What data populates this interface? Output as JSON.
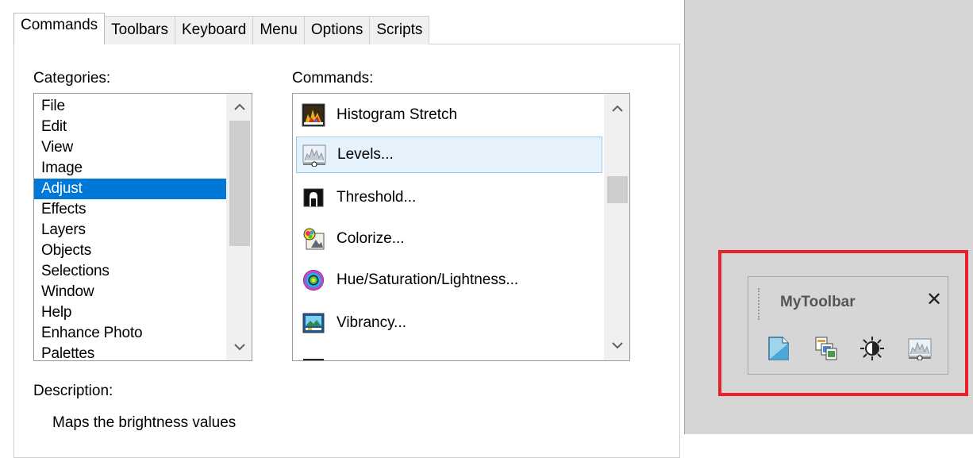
{
  "tabs": [
    {
      "label": "Commands",
      "active": true
    },
    {
      "label": "Toolbars",
      "active": false
    },
    {
      "label": "Keyboard",
      "active": false
    },
    {
      "label": "Menu",
      "active": false
    },
    {
      "label": "Options",
      "active": false
    },
    {
      "label": "Scripts",
      "active": false
    }
  ],
  "categories": {
    "label": "Categories:",
    "items": [
      "File",
      "Edit",
      "View",
      "Image",
      "Adjust",
      "Effects",
      "Layers",
      "Objects",
      "Selections",
      "Window",
      "Help",
      "Enhance Photo",
      "Palettes"
    ],
    "selected": "Adjust"
  },
  "commands": {
    "label": "Commands:",
    "items": [
      {
        "label": "Histogram Stretch",
        "icon": "histogram-stretch-icon"
      },
      {
        "label": "Levels...",
        "icon": "levels-icon",
        "selected": true
      },
      {
        "label": "Threshold...",
        "icon": "threshold-icon"
      },
      {
        "label": "Colorize...",
        "icon": "colorize-icon"
      },
      {
        "label": "Hue/Saturation/Lightness...",
        "icon": "hue-saturation-icon"
      },
      {
        "label": "Vibrancy...",
        "icon": "vibrancy-icon"
      },
      {
        "label": "",
        "icon": "hue-map-icon"
      }
    ]
  },
  "description": {
    "label": "Description:",
    "text": "Maps the brightness values"
  },
  "toolbar": {
    "title": "MyToolbar",
    "close_glyph": "✕",
    "buttons": [
      "new-page-icon",
      "copy-images-icon",
      "brightness-icon",
      "levels-icon"
    ]
  },
  "colors": {
    "selection": "#0078d7",
    "highlight_border": "#e8202a",
    "hover_fill": "#e5f1fb"
  }
}
